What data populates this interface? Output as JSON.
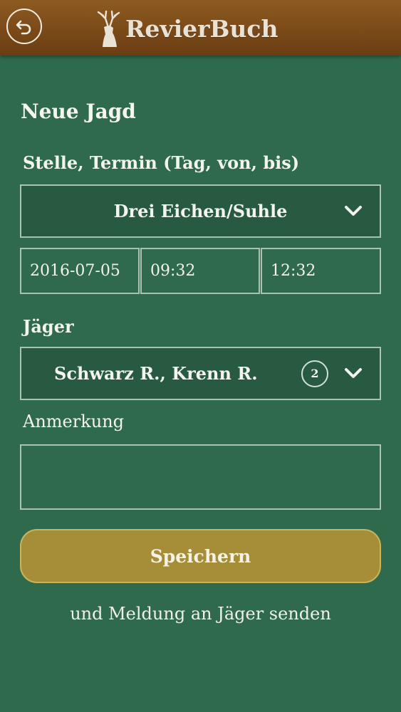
{
  "header": {
    "app_title": "RevierBuch",
    "back_icon": "back-arrow-icon",
    "logo_icon": "stag-icon",
    "colors": {
      "bar": "#7b4a19",
      "logo_text": "#e9e3d6"
    }
  },
  "form": {
    "title": "Neue Jagd",
    "location_label": "Stelle, Termin (Tag, von, bis)",
    "location_value": "Drei Eichen/Suhle",
    "date_value": "2016-07-05",
    "time_from": "09:32",
    "time_to": "12:32",
    "hunters_label": "Jäger",
    "hunters_value": "Schwarz R., Krenn R.",
    "hunters_count": "2",
    "note_label": "Anmerkung",
    "note_value": ""
  },
  "actions": {
    "save_label": "Speichern",
    "save_hint": "und Meldung an Jäger senden"
  },
  "colors": {
    "background": "#2f6a4c",
    "button": "#a58e37",
    "field_border": "#a9c2b2"
  }
}
